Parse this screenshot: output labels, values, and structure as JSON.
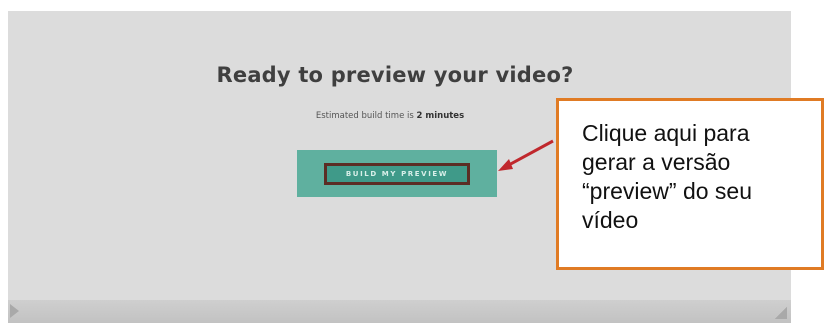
{
  "dialog": {
    "title": "Ready to preview your video?",
    "estimate_prefix": "Estimated build time is ",
    "estimate_value": "2 minutes",
    "build_button_label": "BUILD MY PREVIEW"
  },
  "callout": {
    "lines": [
      "Clique aqui para",
      "gerar a versão",
      "“preview” do seu",
      "vídeo"
    ]
  },
  "colors": {
    "button_bg": "#5fb09f",
    "callout_border": "#e07b24",
    "arrow": "#c0282d",
    "panel_bg": "#dcdcdc"
  }
}
